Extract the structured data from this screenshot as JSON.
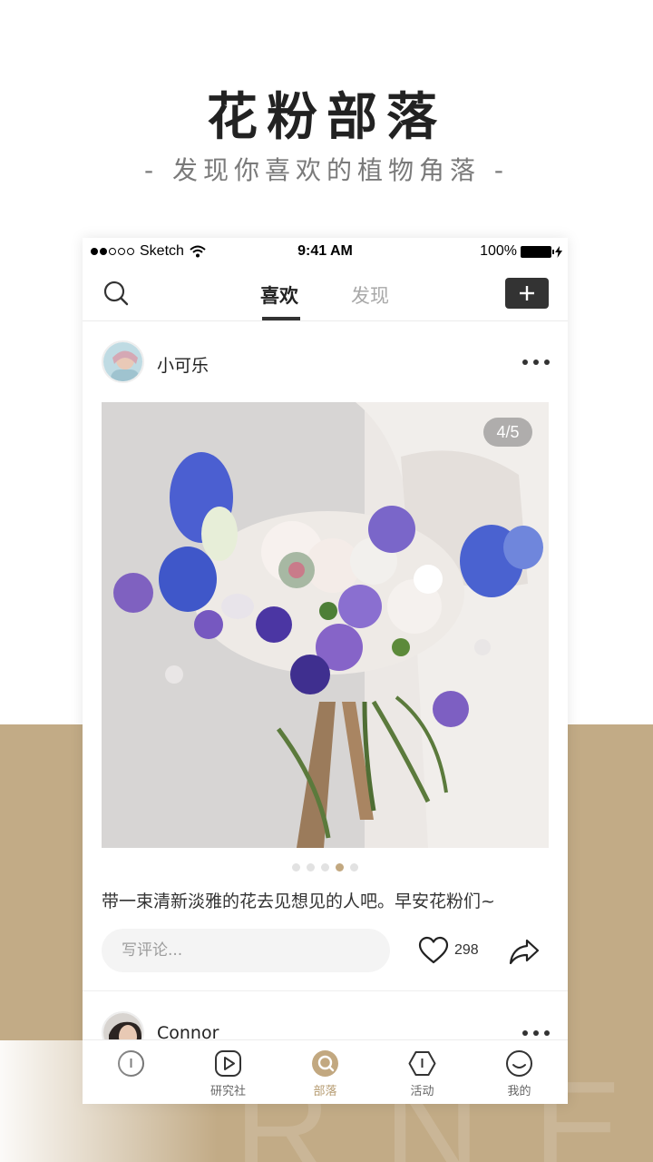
{
  "hero": {
    "title": "花粉部落",
    "subtitle": "- 发现你喜欢的植物角落 -"
  },
  "background_word": "RNER",
  "status_bar": {
    "carrier": "Sketch",
    "time": "9:41 AM",
    "battery": "100%"
  },
  "nav": {
    "tabs": [
      {
        "label": "喜欢",
        "active": true
      },
      {
        "label": "发现",
        "active": false
      }
    ]
  },
  "feed": {
    "posts": [
      {
        "username": "小可乐",
        "image_counter": "4/5",
        "carousel_total": 5,
        "carousel_active": 4,
        "caption": "带一束清新淡雅的花去见想见的人吧。早安花粉们~",
        "comment_placeholder": "写评论...",
        "likes": "298"
      },
      {
        "username": "Connor"
      }
    ]
  },
  "tabbar": {
    "items": [
      {
        "label": "",
        "icon": "home-icon"
      },
      {
        "label": "研究社",
        "icon": "play-icon"
      },
      {
        "label": "部落",
        "icon": "tribe-icon",
        "active": true
      },
      {
        "label": "活动",
        "icon": "hexagon-icon"
      },
      {
        "label": "我的",
        "icon": "smile-icon"
      }
    ]
  },
  "colors": {
    "accent": "#c2a880",
    "band": "#c2ab86",
    "dark": "#333333"
  }
}
